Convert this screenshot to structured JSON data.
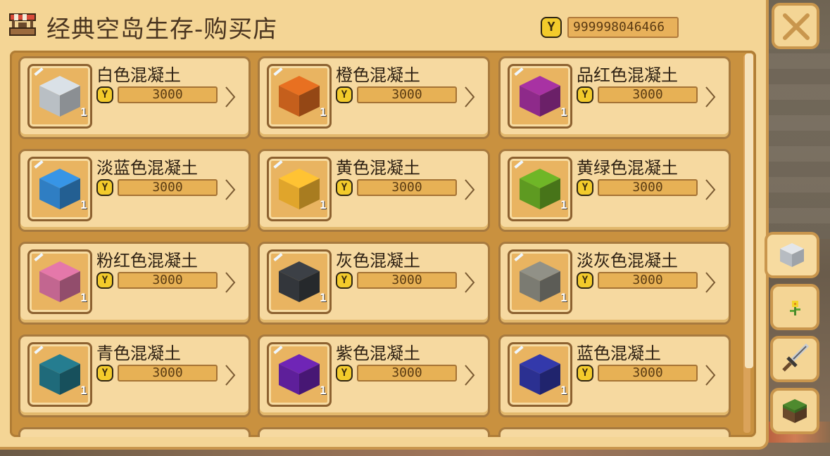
{
  "title": "经典空岛生存-购买店",
  "balance": "999998046466",
  "currency_symbol": "Y",
  "icons": {
    "title": "shop-stall-icon",
    "close": "close-icon",
    "coin": "coin-icon",
    "chevron": "chevron-right-icon",
    "tabs": [
      "concrete-block-icon",
      "flower-icon",
      "sword-icon",
      "grass-block-icon"
    ]
  },
  "items": [
    {
      "name": "白色混凝土",
      "price": "3000",
      "qty": "1",
      "color": "#b9bfc4"
    },
    {
      "name": "橙色混凝土",
      "price": "3000",
      "qty": "1",
      "color": "#c55f1c"
    },
    {
      "name": "品红色混凝土",
      "price": "3000",
      "qty": "1",
      "color": "#8e2a8a"
    },
    {
      "name": "淡蓝色混凝土",
      "price": "3000",
      "qty": "1",
      "color": "#2f7ec3"
    },
    {
      "name": "黄色混凝土",
      "price": "3000",
      "qty": "1",
      "color": "#e0a52b"
    },
    {
      "name": "黄绿色混凝土",
      "price": "3000",
      "qty": "1",
      "color": "#5e9a21"
    },
    {
      "name": "粉红色混凝土",
      "price": "3000",
      "qty": "1",
      "color": "#c26690"
    },
    {
      "name": "灰色混凝土",
      "price": "3000",
      "qty": "1",
      "color": "#33363b"
    },
    {
      "name": "淡灰色混凝土",
      "price": "3000",
      "qty": "1",
      "color": "#7b7b72"
    },
    {
      "name": "青色混凝土",
      "price": "3000",
      "qty": "1",
      "color": "#1f6a7a"
    },
    {
      "name": "紫色混凝土",
      "price": "3000",
      "qty": "1",
      "color": "#5e1f9a"
    },
    {
      "name": "蓝色混凝土",
      "price": "3000",
      "qty": "1",
      "color": "#2b3091"
    }
  ],
  "active_tab": 0
}
